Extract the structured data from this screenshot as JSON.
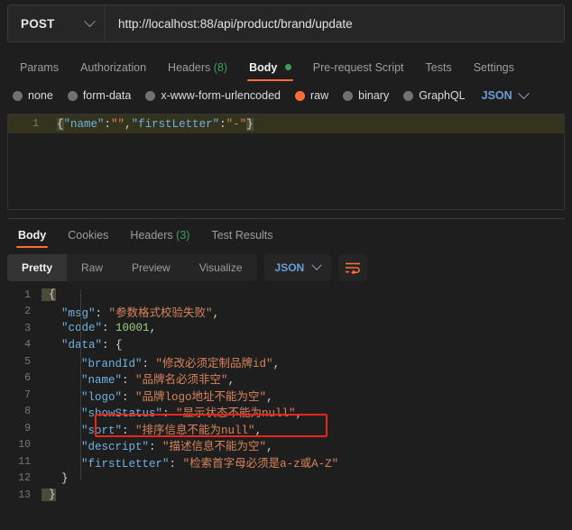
{
  "request": {
    "method": "POST",
    "url": "http://localhost:88/api/product/brand/update",
    "tabs": [
      {
        "label": "Params",
        "active": false
      },
      {
        "label": "Authorization",
        "active": false
      },
      {
        "label": "Headers",
        "count": "(8)",
        "active": false
      },
      {
        "label": "Body",
        "active": true,
        "dot": "green"
      },
      {
        "label": "Pre-request Script",
        "active": false
      },
      {
        "label": "Tests",
        "active": false
      },
      {
        "label": "Settings",
        "active": false
      }
    ],
    "body_types": [
      {
        "label": "none",
        "selected": false
      },
      {
        "label": "form-data",
        "selected": false
      },
      {
        "label": "x-www-form-urlencoded",
        "selected": false
      },
      {
        "label": "raw",
        "selected": true
      },
      {
        "label": "binary",
        "selected": false
      },
      {
        "label": "GraphQL",
        "selected": false
      }
    ],
    "raw_format": "JSON",
    "editor": {
      "line_number": "1",
      "brace_open": "{",
      "key_name": "\"name\"",
      "colon1": ":",
      "val_name": "\"\"",
      "comma": ",",
      "key_first": "\"firstLetter\"",
      "colon2": ":",
      "val_first": "\"-\"",
      "brace_close": "}"
    }
  },
  "response": {
    "tabs": [
      {
        "label": "Body",
        "active": true
      },
      {
        "label": "Cookies",
        "active": false
      },
      {
        "label": "Headers",
        "count": "(3)",
        "active": false
      },
      {
        "label": "Test Results",
        "active": false
      }
    ],
    "view_modes": [
      {
        "label": "Pretty",
        "active": true
      },
      {
        "label": "Raw",
        "active": false
      },
      {
        "label": "Preview",
        "active": false
      },
      {
        "label": "Visualize",
        "active": false
      }
    ],
    "format": "JSON",
    "wrap_icon": "word-wrap-icon",
    "highlight_color": "#e8251f",
    "lines": [
      {
        "n": "1",
        "indent": 0
      },
      {
        "n": "2",
        "indent": 1,
        "key": "\"msg\"",
        "value": "\"参数格式校验失败\"",
        "type": "string",
        "comma": ","
      },
      {
        "n": "3",
        "indent": 1,
        "key": "\"code\"",
        "value": "10001",
        "type": "number",
        "comma": ","
      },
      {
        "n": "4",
        "indent": 1,
        "key": "\"data\"",
        "value": "{",
        "type": "brace",
        "comma": ""
      },
      {
        "n": "5",
        "indent": 2,
        "key": "\"brandId\"",
        "value": "\"修改必须定制品牌id\"",
        "type": "string",
        "comma": ","
      },
      {
        "n": "6",
        "indent": 2,
        "key": "\"name\"",
        "value": "\"品牌名必须非空\"",
        "type": "string",
        "comma": ","
      },
      {
        "n": "7",
        "indent": 2,
        "key": "\"logo\"",
        "value": "\"品牌logo地址不能为空\"",
        "type": "string",
        "comma": ","
      },
      {
        "n": "8",
        "indent": 2,
        "key": "\"showStatus\"",
        "value": "\"显示状态不能为null\"",
        "type": "string",
        "comma": ",",
        "highlighted": true
      },
      {
        "n": "9",
        "indent": 2,
        "key": "\"sort\"",
        "value": "\"排序信息不能为null\"",
        "type": "string",
        "comma": ","
      },
      {
        "n": "10",
        "indent": 2,
        "key": "\"descript\"",
        "value": "\"描述信息不能为空\"",
        "type": "string",
        "comma": ","
      },
      {
        "n": "11",
        "indent": 2,
        "key": "\"firstLetter\"",
        "value": "\"检索首字母必须是a-z或A-Z\"",
        "type": "string",
        "comma": ""
      },
      {
        "n": "12",
        "indent": 1,
        "close": "}"
      },
      {
        "n": "13",
        "indent": 0,
        "close": "}"
      }
    ],
    "open_brace": "{",
    "colon": ":"
  }
}
